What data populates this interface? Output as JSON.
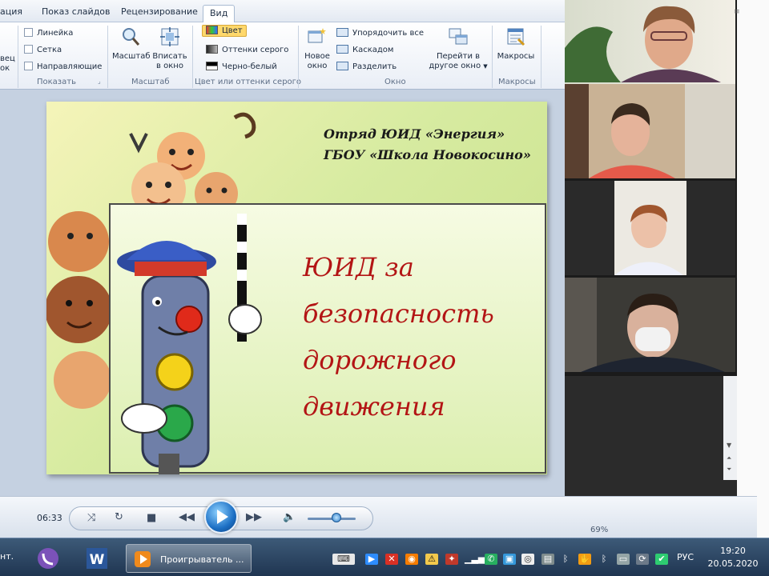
{
  "ribbon": {
    "tabs": [
      "ация",
      "Показ слайдов",
      "Рецензирование",
      "Вид"
    ],
    "active_tab": "Вид",
    "show_group": {
      "label": "Показать",
      "items": [
        "Линейка",
        "Сетка",
        "Направляющие"
      ]
    },
    "left_cut": [
      "вец",
      "ок"
    ],
    "zoom_group": {
      "label": "Масштаб",
      "zoom": "Масштаб",
      "fit_line1": "Вписать",
      "fit_line2": "в окно"
    },
    "color_group": {
      "label": "Цвет или оттенки серого",
      "items": [
        "Цвет",
        "Оттенки серого",
        "Черно-белый"
      ]
    },
    "window_group": {
      "label": "Окно",
      "new_line1": "Новое",
      "new_line2": "окно",
      "arrange_all": "Упорядочить все",
      "cascade": "Каскадом",
      "split": "Разделить",
      "switch_line1": "Перейти в",
      "switch_line2": "другое окно"
    },
    "macros_group": {
      "label": "Макросы",
      "macros": "Макросы"
    }
  },
  "slide": {
    "header_line1": "Отряд ЮИД «Энергия»",
    "header_line2": "ГБОУ «Школа  Новокосино»",
    "title_lines": [
      "ЮИД за",
      "безопасность",
      "дорожного",
      "движения"
    ]
  },
  "player": {
    "elapsed": "06:33",
    "volume_level": 0.6,
    "zoom_readout": "69%"
  },
  "taskbar": {
    "task_label": "Проигрыватель ...",
    "language": "РУС",
    "time": "19:20",
    "date": "20.05.2020",
    "left_cut": "нт."
  },
  "colors": {
    "title_red": "#b31515",
    "ribbon_accent": "#ffd86b",
    "taskbar": "#1f3551"
  }
}
